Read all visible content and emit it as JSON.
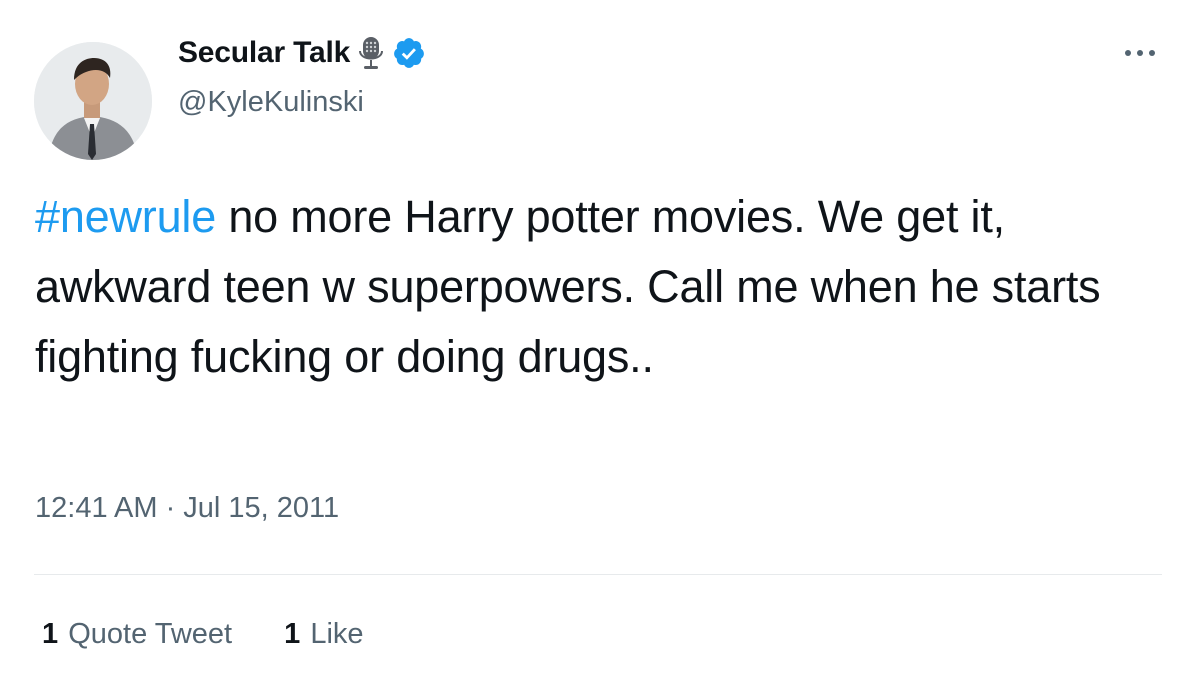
{
  "author": {
    "display_name": "Secular Talk",
    "handle": "@KyleKulinski",
    "avatar_icon": "person-avatar",
    "name_icons": [
      "microphone-icon",
      "verified-badge-icon"
    ],
    "verified_color": "#1d9bf0"
  },
  "menu": {
    "icon": "more-options-icon"
  },
  "tweet": {
    "hashtag": "#newrule",
    "text": " no more Harry potter movies. We get it, awkward teen w superpowers. Call me when he starts fighting fucking or doing drugs..",
    "timestamp": "12:41 AM · Jul 15, 2011"
  },
  "stats": {
    "quote_count": "1",
    "quote_label": "Quote Tweet",
    "like_count": "1",
    "like_label": "Like"
  },
  "colors": {
    "link": "#1d9bf0",
    "text": "#0f1419",
    "secondary": "#536471",
    "divider": "#e7eaec"
  }
}
